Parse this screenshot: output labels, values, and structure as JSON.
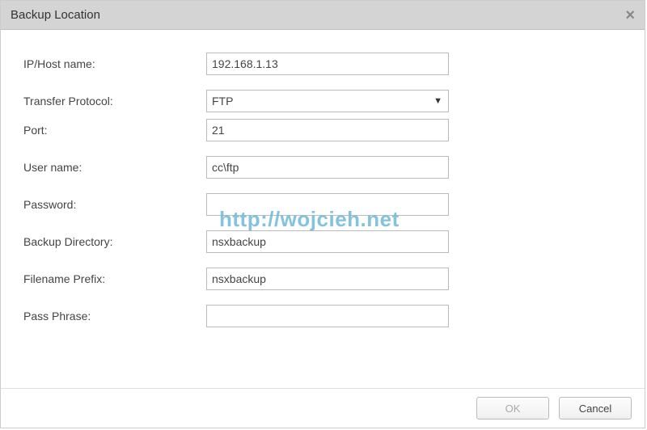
{
  "dialog": {
    "title": "Backup Location"
  },
  "form": {
    "ip_host_label": "IP/Host name:",
    "ip_host_value": "192.168.1.13",
    "protocol_label": "Transfer Protocol:",
    "protocol_value": "FTP",
    "port_label": "Port:",
    "port_value": "21",
    "username_label": "User name:",
    "username_value": "cc\\ftp",
    "password_label": "Password:",
    "password_value": "",
    "backup_dir_label": "Backup Directory:",
    "backup_dir_value": "nsxbackup",
    "filename_prefix_label": "Filename Prefix:",
    "filename_prefix_value": "nsxbackup",
    "passphrase_label": "Pass Phrase:",
    "passphrase_value": ""
  },
  "buttons": {
    "ok": "OK",
    "cancel": "Cancel"
  },
  "watermark": "http://wojcieh.net"
}
